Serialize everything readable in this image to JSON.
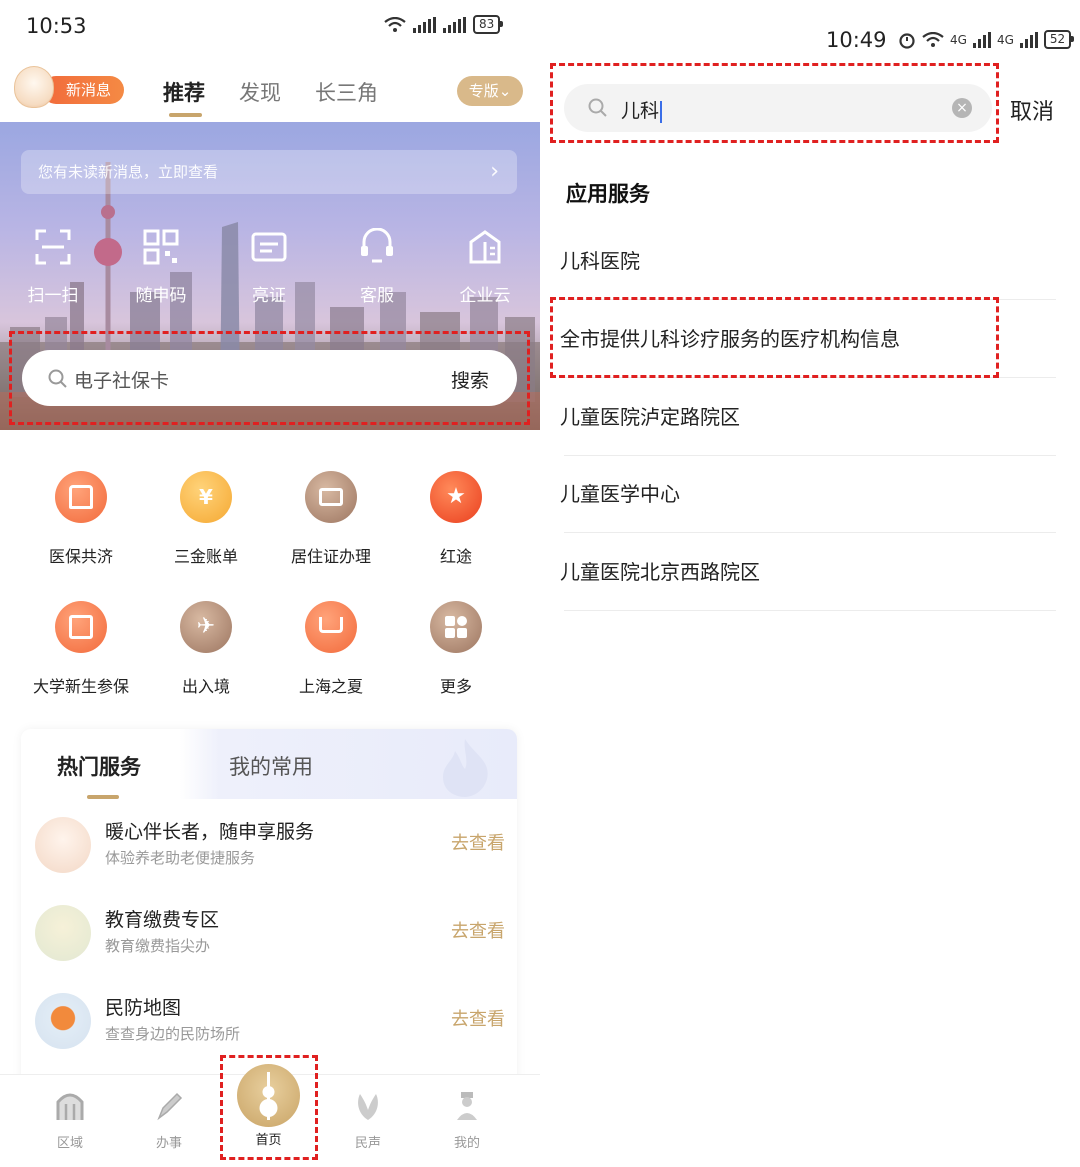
{
  "left_screen": {
    "status_bar": {
      "time": "10:53",
      "battery": "83"
    },
    "header": {
      "new_message_badge": "新消息",
      "tabs": [
        {
          "label": "推荐",
          "active": true
        },
        {
          "label": "发现",
          "active": false
        },
        {
          "label": "长三角",
          "active": false
        }
      ],
      "edition_button": "专版⌄"
    },
    "hero": {
      "unread_notice": "您有未读新消息，立即查看",
      "quick_actions": [
        {
          "label": "扫一扫",
          "icon": "scan-icon"
        },
        {
          "label": "随申码",
          "icon": "qr-code-icon"
        },
        {
          "label": "亮证",
          "icon": "id-card-icon"
        },
        {
          "label": "客服",
          "icon": "customer-service-icon"
        },
        {
          "label": "企业云",
          "icon": "building-icon"
        }
      ],
      "search": {
        "placeholder": "电子社保卡",
        "button": "搜索"
      }
    },
    "services": [
      {
        "label": "医保共济",
        "icon": "family-house-icon",
        "color": "#f47845"
      },
      {
        "label": "三金账单",
        "icon": "yuan-house-icon",
        "color": "#f7b642"
      },
      {
        "label": "居住证办理",
        "icon": "residence-card-icon",
        "color": "#b58e75"
      },
      {
        "label": "红途",
        "icon": "red-star-icon",
        "color": "#f0562f"
      },
      {
        "label": "大学新生参保",
        "icon": "enrollment-icon",
        "color": "#f47845"
      },
      {
        "label": "出入境",
        "icon": "airplane-icon",
        "color": "#b58e75"
      },
      {
        "label": "上海之夏",
        "icon": "shopping-cart-icon",
        "color": "#f47845"
      },
      {
        "label": "更多",
        "icon": "more-apps-icon",
        "color": "#b58e75"
      }
    ],
    "hot_card": {
      "tabs": [
        "热门服务",
        "我的常用"
      ],
      "items": [
        {
          "title": "暖心伴长者，随申享服务",
          "subtitle": "体验养老助老便捷服务",
          "action": "去查看"
        },
        {
          "title": "教育缴费专区",
          "subtitle": "教育缴费指尖办",
          "action": "去查看"
        },
        {
          "title": "民防地图",
          "subtitle": "查查身边的民防场所",
          "action": "去查看"
        }
      ]
    },
    "bottom_nav": [
      {
        "label": "区域",
        "icon": "district-icon"
      },
      {
        "label": "办事",
        "icon": "pen-icon"
      },
      {
        "label": "首页",
        "icon": "home-tower-icon",
        "active": true
      },
      {
        "label": "民声",
        "icon": "voice-icon"
      },
      {
        "label": "我的",
        "icon": "profile-icon"
      }
    ]
  },
  "right_screen": {
    "status_bar": {
      "time": "10:49",
      "battery": "52",
      "network": "4G"
    },
    "search": {
      "value": "儿科",
      "cancel": "取消"
    },
    "section_title": "应用服务",
    "results": [
      "儿科医院",
      "全市提供儿科诊疗服务的医疗机构信息",
      "儿童医院泸定路院区",
      "儿童医学中心",
      "儿童医院北京西路院区"
    ]
  },
  "colors": {
    "accent_gold": "#c8a56c",
    "highlight_red": "#e02020",
    "orange": "#f47845"
  }
}
